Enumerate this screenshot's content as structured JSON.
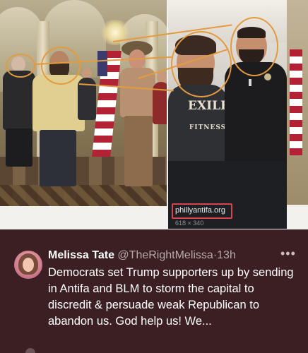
{
  "image": {
    "source_domain": "phillyantifa.org",
    "source_dimensions": "618 × 340",
    "shirt_text_1": "EXILE",
    "shirt_text_2": "FITNESS"
  },
  "tweet": {
    "display_name": "Melissa Tate",
    "handle": "@TheRightMelissa",
    "separator": "·",
    "time": "13h",
    "more_icon": "more-horizontal-icon",
    "text": "Democrats set Trump supporters up by sending in Antifa and BLM to storm the capital to discredit & persuade weak Republican to abandon us. God help us! We..."
  },
  "colors": {
    "background": "#3b1f22",
    "highlight_circle": "#e39b3f",
    "source_box": "#d9434b",
    "secondary_text": "#b7a8aa"
  }
}
